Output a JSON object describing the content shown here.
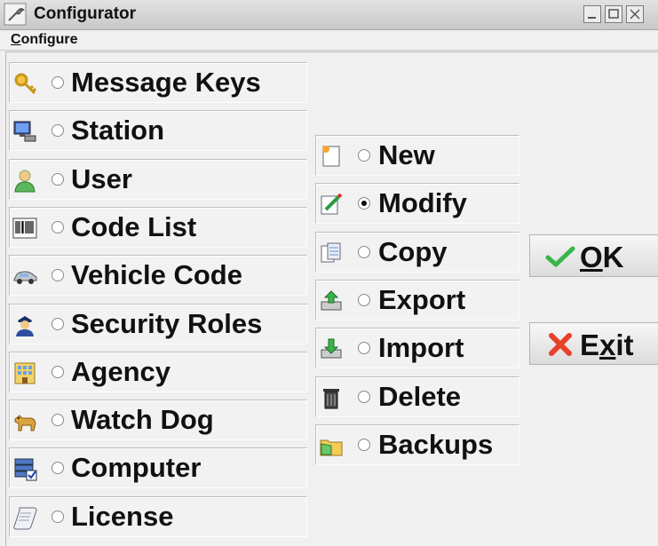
{
  "window": {
    "title": "Configurator"
  },
  "menu": {
    "configure_label": "Configure"
  },
  "categories": [
    {
      "label": "Message Keys",
      "icon": "key-icon",
      "selected": false
    },
    {
      "label": "Station",
      "icon": "computer-station-icon",
      "selected": false
    },
    {
      "label": "User",
      "icon": "user-icon",
      "selected": false
    },
    {
      "label": "Code List",
      "icon": "barcode-icon",
      "selected": false
    },
    {
      "label": "Vehicle Code",
      "icon": "car-icon",
      "selected": false
    },
    {
      "label": "Security Roles",
      "icon": "officer-icon",
      "selected": false
    },
    {
      "label": "Agency",
      "icon": "building-icon",
      "selected": false
    },
    {
      "label": "Watch Dog",
      "icon": "dog-icon",
      "selected": false
    },
    {
      "label": "Computer",
      "icon": "server-check-icon",
      "selected": false
    },
    {
      "label": "License",
      "icon": "scroll-icon",
      "selected": false
    }
  ],
  "actions": [
    {
      "label": "New",
      "icon": "new-document-icon",
      "selected": false
    },
    {
      "label": "Modify",
      "icon": "edit-document-icon",
      "selected": true
    },
    {
      "label": "Copy",
      "icon": "copy-icon",
      "selected": false
    },
    {
      "label": "Export",
      "icon": "export-icon",
      "selected": false
    },
    {
      "label": "Import",
      "icon": "import-icon",
      "selected": false
    },
    {
      "label": "Delete",
      "icon": "trash-icon",
      "selected": false
    },
    {
      "label": "Backups",
      "icon": "folder-icon",
      "selected": false
    }
  ],
  "buttons": {
    "ok": {
      "label_underlined": "O",
      "label_rest": "K",
      "icon": "check-icon"
    },
    "exit": {
      "label_first": "E",
      "label_underlined": "x",
      "label_rest": "it",
      "icon": "x-mark-icon"
    }
  },
  "colors": {
    "check_green": "#39b54a",
    "exit_red": "#e8402a"
  }
}
